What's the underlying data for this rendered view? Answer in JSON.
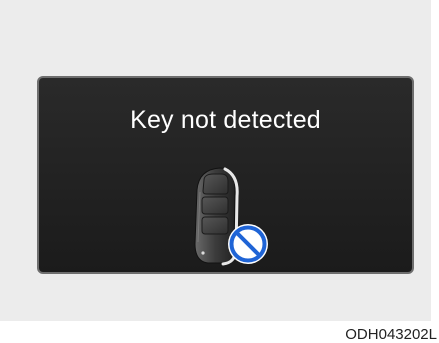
{
  "screen": {
    "message": "Key not detected",
    "icon": "smart-key-fob-icon",
    "status_icon": "prohibited-icon",
    "status_color": "#1f64d6"
  },
  "figure": {
    "code": "ODH043202L"
  }
}
